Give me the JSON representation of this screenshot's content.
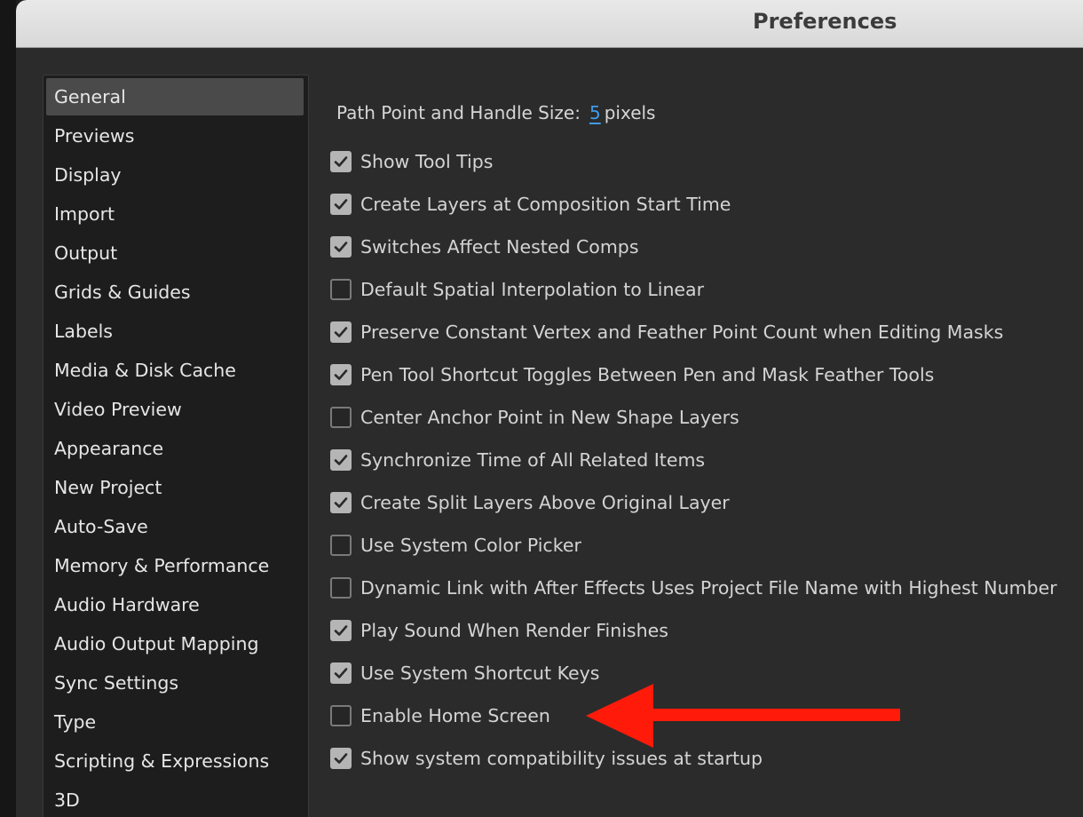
{
  "window": {
    "title": "Preferences"
  },
  "sidebar": {
    "items": [
      {
        "label": "General",
        "selected": true
      },
      {
        "label": "Previews"
      },
      {
        "label": "Display"
      },
      {
        "label": "Import"
      },
      {
        "label": "Output"
      },
      {
        "label": "Grids & Guides"
      },
      {
        "label": "Labels"
      },
      {
        "label": "Media & Disk Cache"
      },
      {
        "label": "Video Preview"
      },
      {
        "label": "Appearance"
      },
      {
        "label": "New Project"
      },
      {
        "label": "Auto-Save"
      },
      {
        "label": "Memory & Performance"
      },
      {
        "label": "Audio Hardware"
      },
      {
        "label": "Audio Output Mapping"
      },
      {
        "label": "Sync Settings"
      },
      {
        "label": "Type"
      },
      {
        "label": "Scripting & Expressions"
      },
      {
        "label": "3D"
      }
    ]
  },
  "general": {
    "path_point_label": "Path Point and Handle Size:",
    "path_point_value": "5",
    "path_point_unit": "pixels",
    "options": [
      {
        "label": "Show Tool Tips",
        "checked": true
      },
      {
        "label": "Create Layers at Composition Start Time",
        "checked": true
      },
      {
        "label": "Switches Affect Nested Comps",
        "checked": true
      },
      {
        "label": "Default Spatial Interpolation to Linear",
        "checked": false
      },
      {
        "label": "Preserve Constant Vertex and Feather Point Count when Editing Masks",
        "checked": true
      },
      {
        "label": "Pen Tool Shortcut Toggles Between Pen and Mask Feather Tools",
        "checked": true
      },
      {
        "label": "Center Anchor Point in New Shape Layers",
        "checked": false
      },
      {
        "label": "Synchronize Time of All Related Items",
        "checked": true
      },
      {
        "label": "Create Split Layers Above Original Layer",
        "checked": true
      },
      {
        "label": "Use System Color Picker",
        "checked": false
      },
      {
        "label": "Dynamic Link with After Effects Uses Project File Name with Highest Number",
        "checked": false
      },
      {
        "label": "Play Sound When Render Finishes",
        "checked": true
      },
      {
        "label": "Use System Shortcut Keys",
        "checked": true
      },
      {
        "label": "Enable Home Screen",
        "checked": false
      },
      {
        "label": "Show system compatibility issues at startup",
        "checked": true
      }
    ]
  },
  "annotation": {
    "color": "#ff1a0a",
    "icon": "red-arrow-pointing-left"
  }
}
